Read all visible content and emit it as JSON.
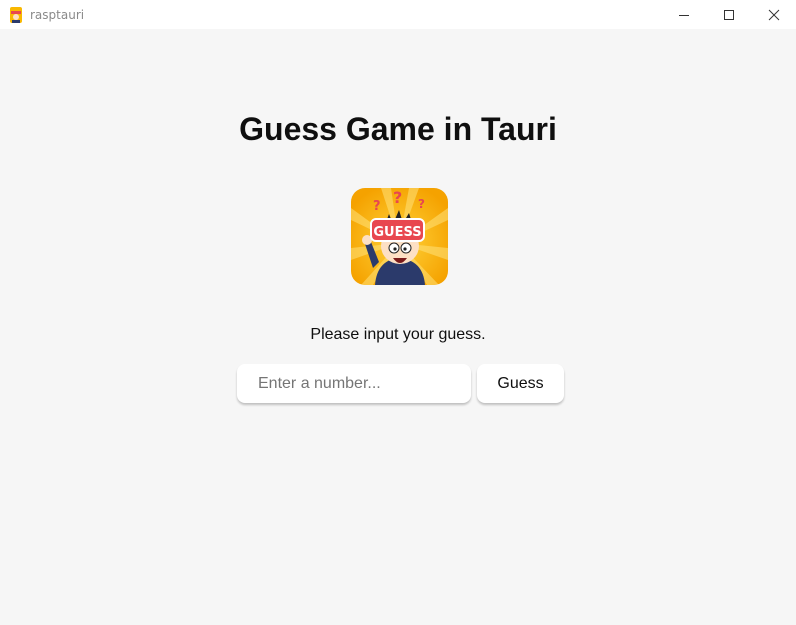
{
  "window": {
    "title": "rasptauri",
    "controls": [
      "minimize-icon",
      "maximize-icon",
      "close-icon"
    ]
  },
  "main": {
    "heading": "Guess Game in Tauri",
    "logo_text": "GUESS",
    "prompt": "Please input your guess.",
    "input": {
      "value": "",
      "placeholder": "Enter a number..."
    },
    "button_label": "Guess"
  },
  "colors": {
    "background": "#f6f6f6",
    "text": "#0f0f0f",
    "logo_yellow": "#f9b800",
    "logo_sign_red": "#e8474f"
  }
}
